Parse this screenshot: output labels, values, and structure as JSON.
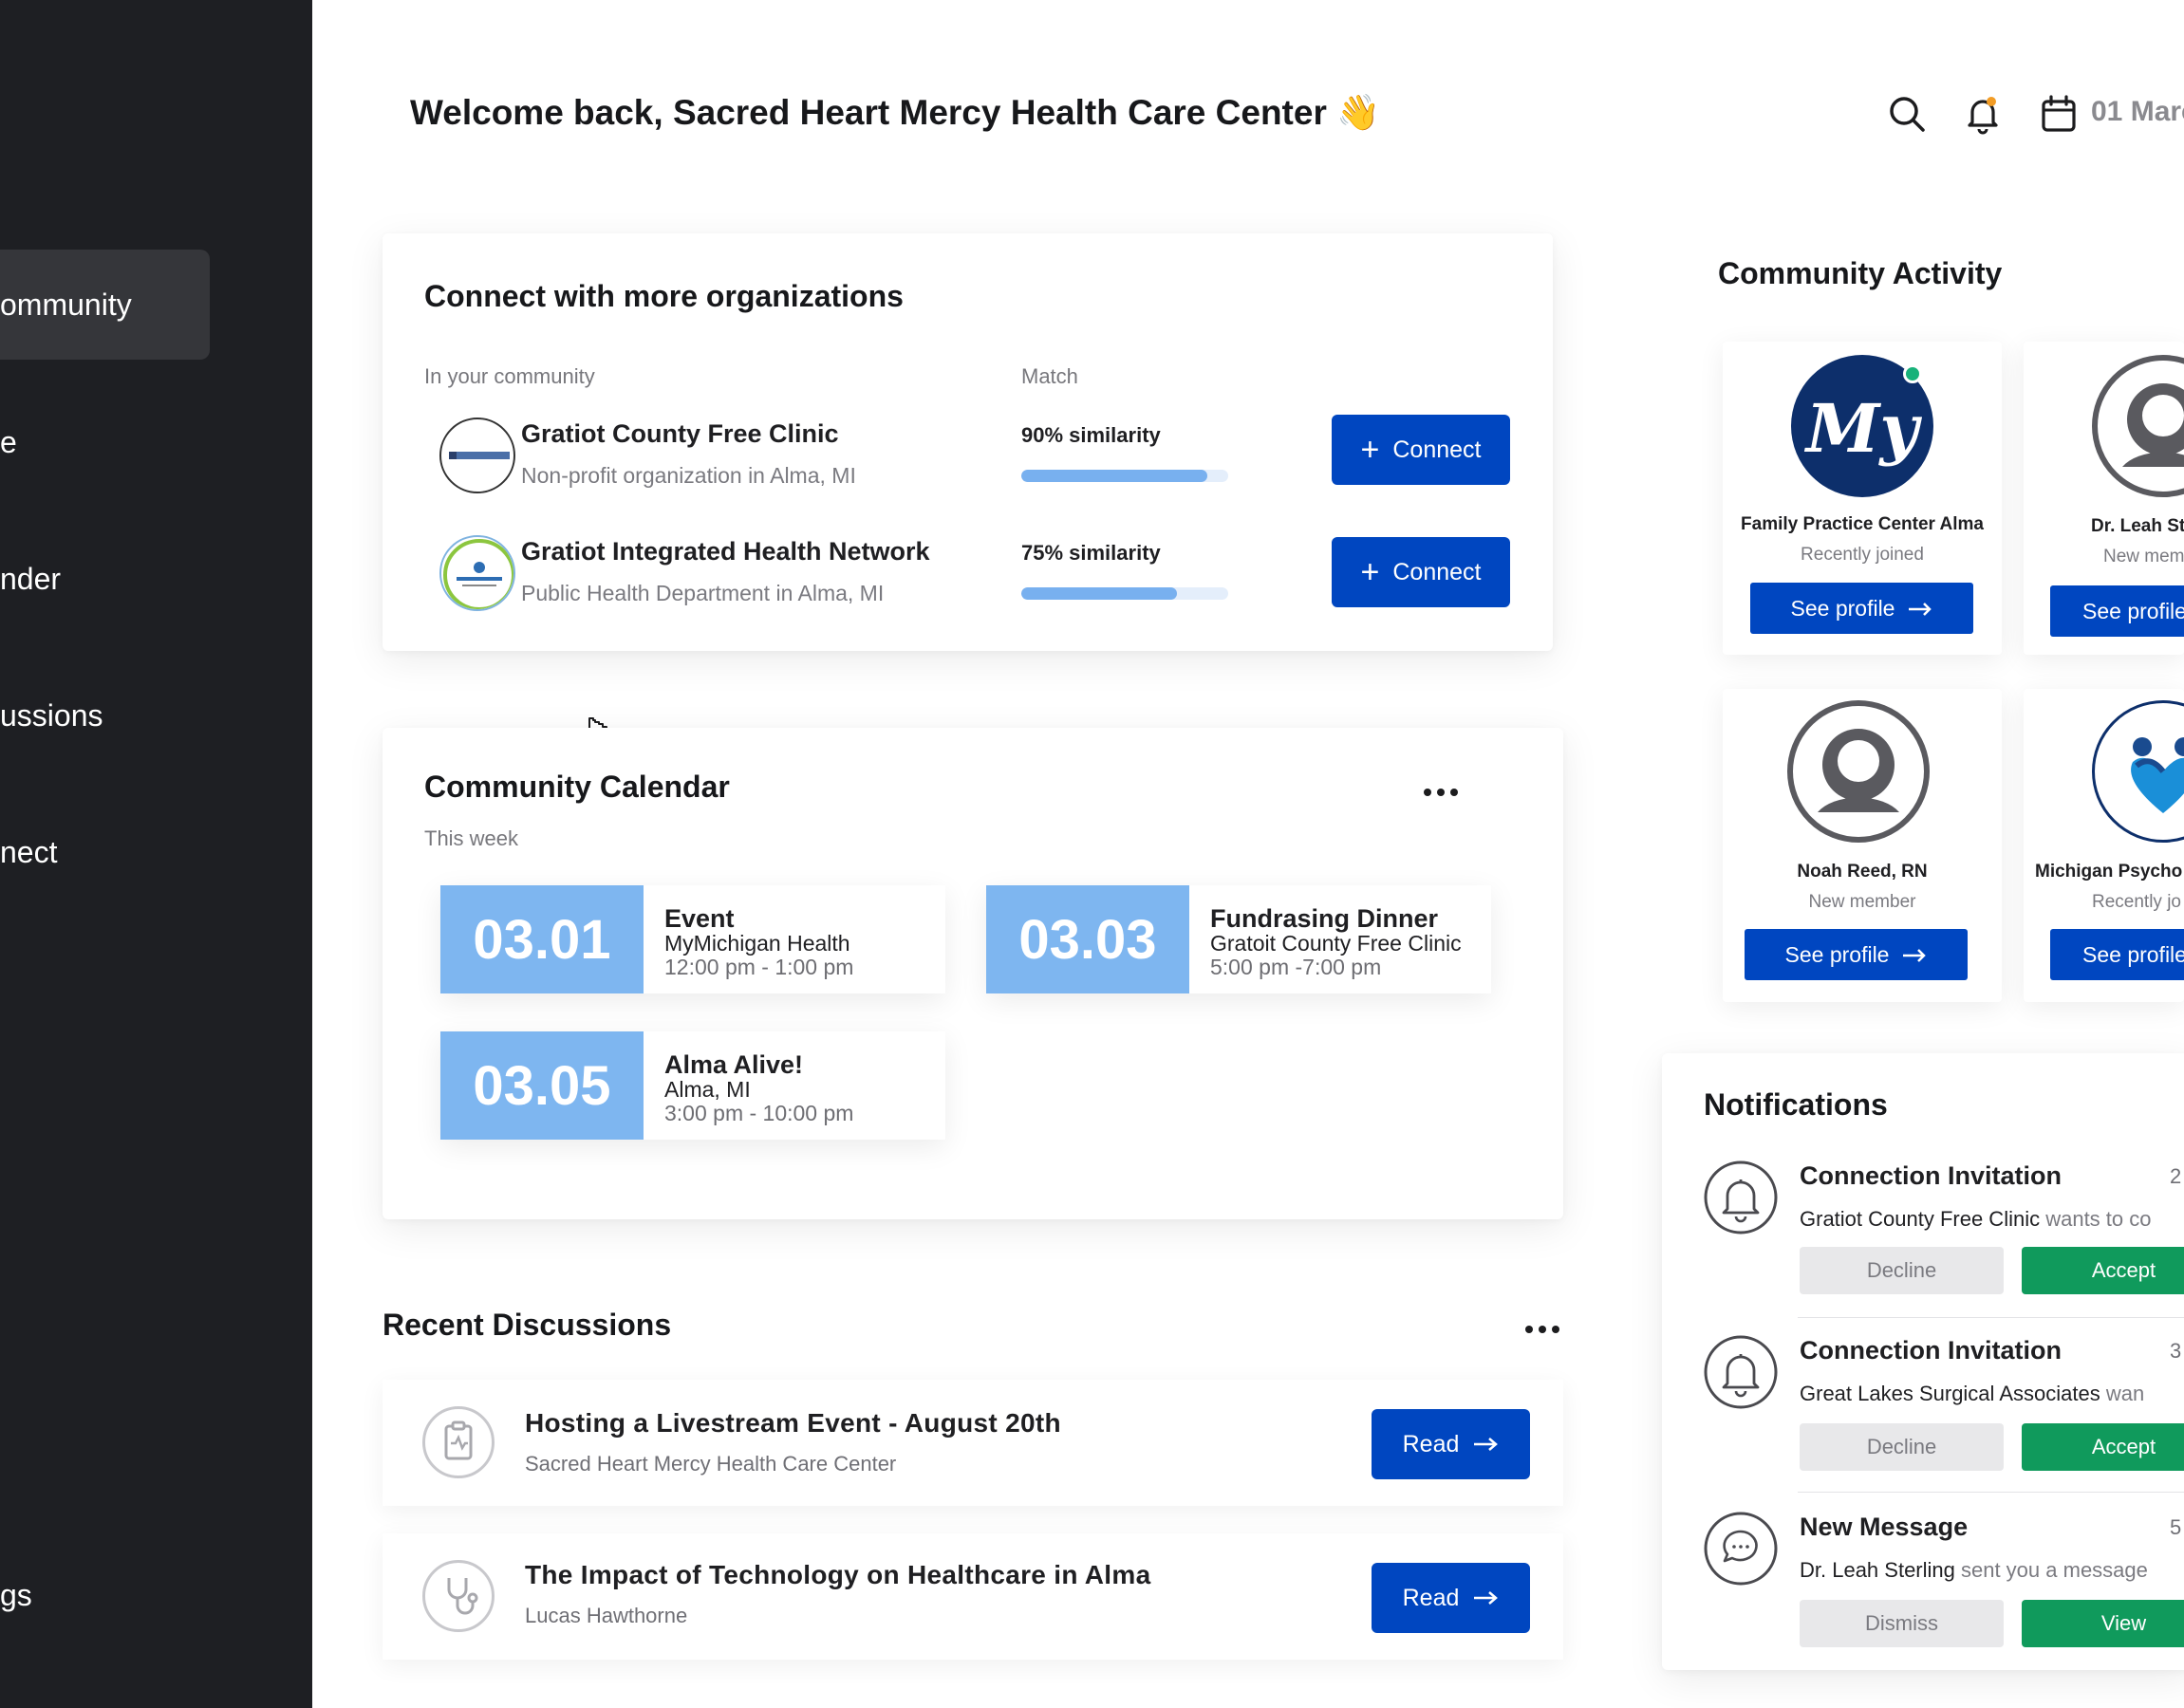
{
  "colors": {
    "accent_blue": "#0046c0",
    "accept_green": "#109a5c",
    "sidebar": "#1e1f23",
    "date_tile": "#7eb6f0"
  },
  "sidebar": {
    "items": [
      {
        "label": "ommunity",
        "active": true
      },
      {
        "label": "e"
      },
      {
        "label": "nder"
      },
      {
        "label": "ussions"
      },
      {
        "label": "nect"
      },
      {
        "label": "gs"
      }
    ]
  },
  "header": {
    "title": "Welcome back, Sacred Heart Mercy Health Care Center 👋",
    "date": "01 Marc",
    "icons": [
      "search-icon",
      "bell-icon",
      "calendar-icon"
    ]
  },
  "connect": {
    "title": "Connect with more organizations",
    "col_community": "In your community",
    "col_match": "Match",
    "orgs": [
      {
        "name": "Gratiot County Free Clinic",
        "desc": "Non-profit organization in Alma, MI",
        "similarity": "90% similarity",
        "match": 0.9,
        "button": "Connect"
      },
      {
        "name": "Gratiot Integrated Health Network",
        "desc": "Public Health Department in Alma, MI",
        "similarity": "75% similarity",
        "match": 0.75,
        "button": "Connect"
      }
    ]
  },
  "calendar": {
    "title": "Community Calendar",
    "subtitle": "This week",
    "events": [
      {
        "date": "03.01",
        "title": "Event",
        "org": "MyMichigan Health",
        "time": "12:00 pm - 1:00 pm"
      },
      {
        "date": "03.03",
        "title": "Fundrasing Dinner",
        "org": "Gratoit County Free Clinic",
        "time": "5:00 pm -7:00 pm"
      },
      {
        "date": "03.05",
        "title": "Alma Alive!",
        "org": "Alma, MI",
        "time": "3:00 pm - 10:00 pm"
      }
    ]
  },
  "discussions": {
    "title": "Recent Discussions",
    "items": [
      {
        "title": "Hosting a Livestream Event - August 20th",
        "author": "Sacred Heart Mercy  Health Care Center",
        "button": "Read"
      },
      {
        "title": "The Impact of Technology on Healthcare in Alma",
        "author": "Lucas Hawthorne",
        "button": "Read"
      }
    ]
  },
  "activity": {
    "title": "Community Activity",
    "members": [
      {
        "name": "Family Practice Center Alma",
        "status": "Recently joined",
        "button": "See profile",
        "logo_text": "My"
      },
      {
        "name": "Dr. Leah Ste",
        "status": "New mem",
        "button": "See profile"
      },
      {
        "name": "Noah Reed, RN",
        "status": "New member",
        "button": "See profile"
      },
      {
        "name": "Michigan Psycho",
        "status": "Recently jo",
        "button": "See profile"
      }
    ]
  },
  "notifications": {
    "title": "Notifications",
    "items": [
      {
        "title": "Connection Invitation",
        "time": "2",
        "actor": "Gratiot County Free Clinic",
        "text": " wants to co",
        "secondary": "Decline",
        "primary": "Accept"
      },
      {
        "title": "Connection Invitation",
        "time": "3",
        "actor": "Great Lakes Surgical Associates",
        "text": " wan",
        "secondary": "Decline",
        "primary": "Accept"
      },
      {
        "title": "New Message",
        "time": "5",
        "actor": "Dr. Leah Sterling",
        "text": " sent you a message",
        "secondary": "Dismiss",
        "primary": "View"
      }
    ]
  }
}
